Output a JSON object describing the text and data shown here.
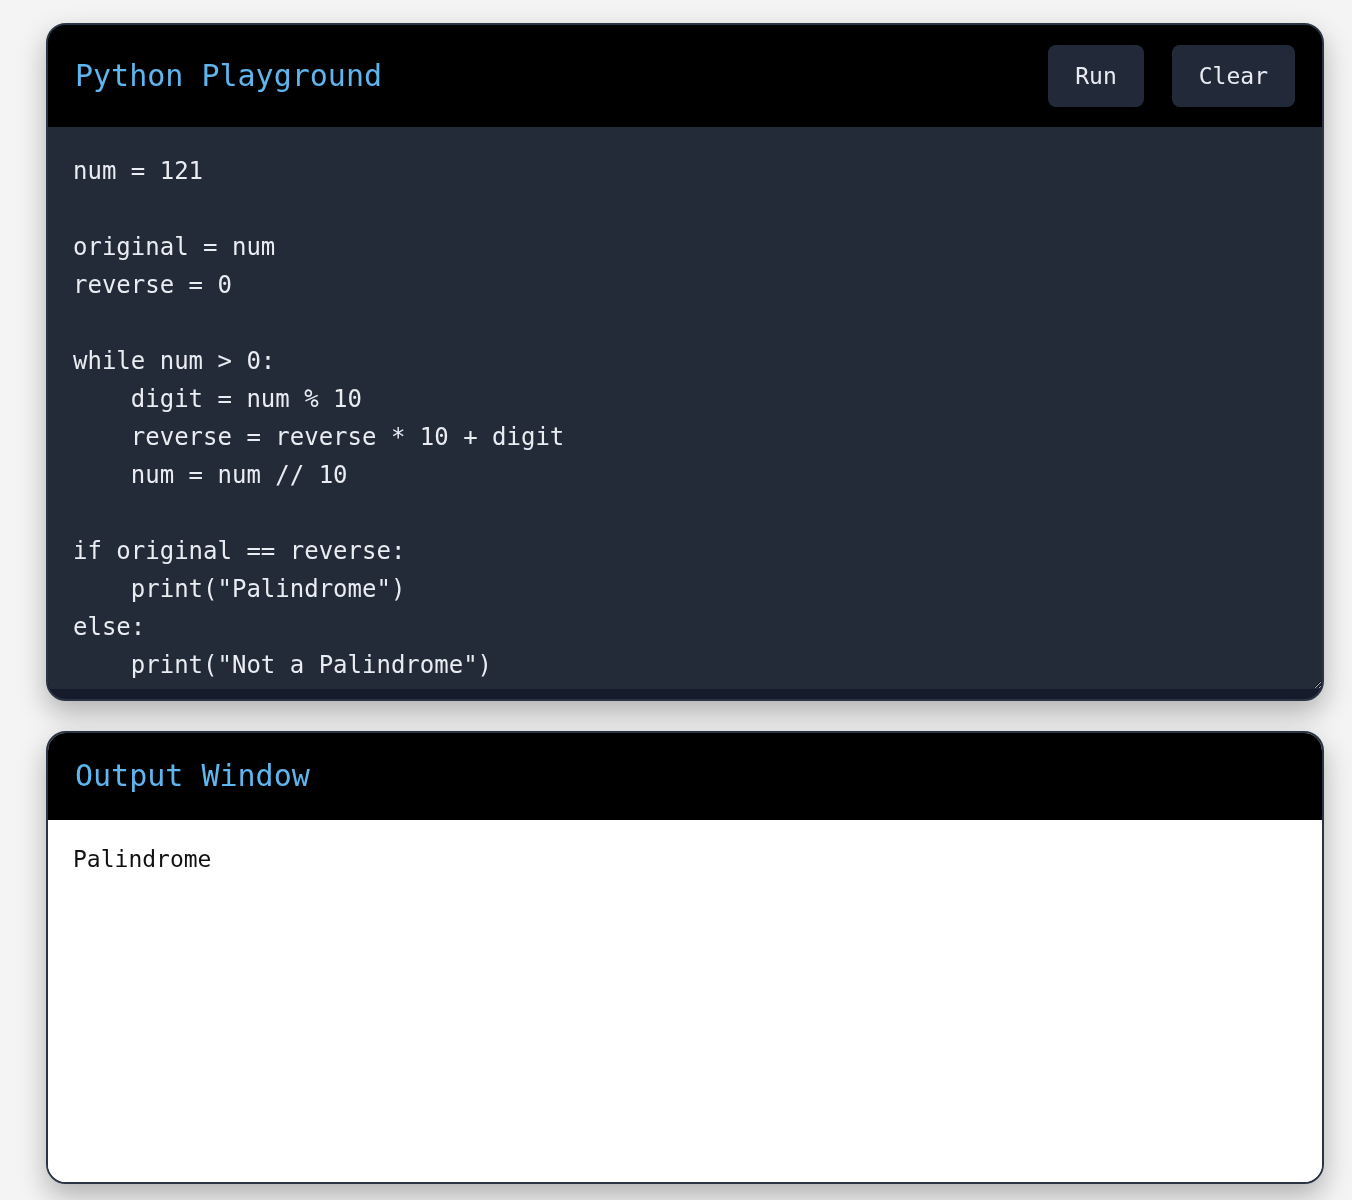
{
  "editor": {
    "title": "Python Playground",
    "buttons": [
      "Run",
      "Clear"
    ],
    "value": "num = 121\n\noriginal = num\nreverse = 0\n\nwhile num > 0:\n    digit = num % 10\n    reverse = reverse * 10 + digit\n    num = num // 10\n\nif original == reverse:\n    print(\"Palindrome\")\nelse:\n    print(\"Not a Palindrome\")"
  },
  "output": {
    "title": "Output Window",
    "text": "Palindrome"
  }
}
